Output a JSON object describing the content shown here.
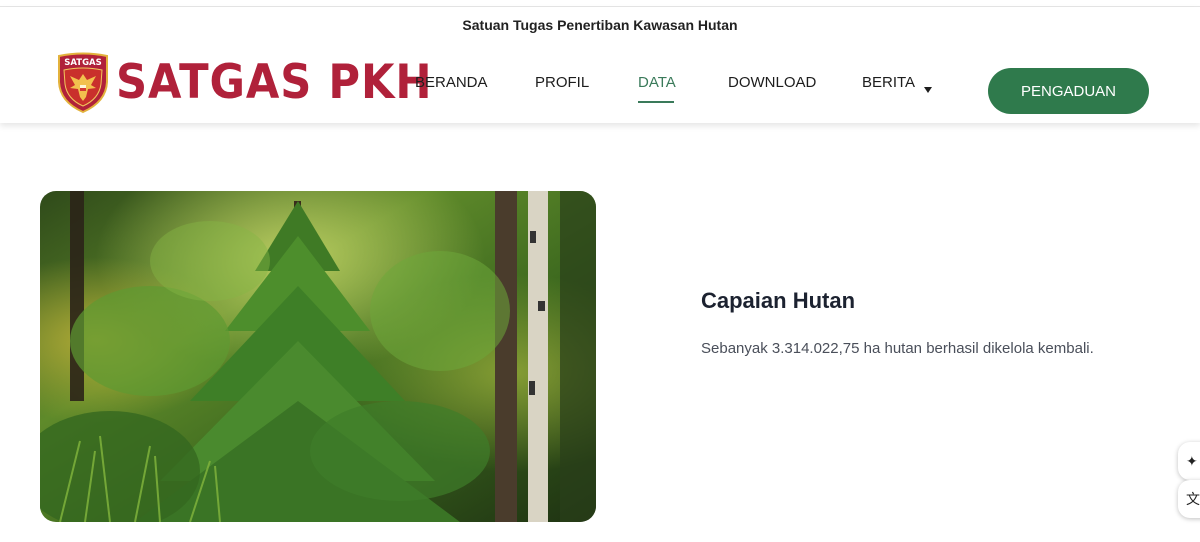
{
  "header": {
    "tagline": "Satuan Tugas Penertiban Kawasan Hutan",
    "logo_text": "SATGAS PKH",
    "emblem_text": "SATGAS"
  },
  "nav": {
    "items": [
      {
        "label": "BERANDA"
      },
      {
        "label": "PROFIL"
      },
      {
        "label": "DATA",
        "active": true
      },
      {
        "label": "DOWNLOAD"
      },
      {
        "label": "BERITA",
        "has_dropdown": true
      }
    ],
    "cta_label": "PENGADUAN"
  },
  "content": {
    "heading": "Capaian Hutan",
    "description": "Sebanyak 3.314.022,75 ha hutan berhasil dikelola kembali.",
    "image": "forest-photo"
  },
  "floating": {
    "sparkle_icon": "sparkle-icon",
    "translate_icon": "translate-icon"
  },
  "colors": {
    "brand_red": "#b0213a",
    "brand_green": "#2f7a4c",
    "active_nav": "#3a7a5a"
  }
}
